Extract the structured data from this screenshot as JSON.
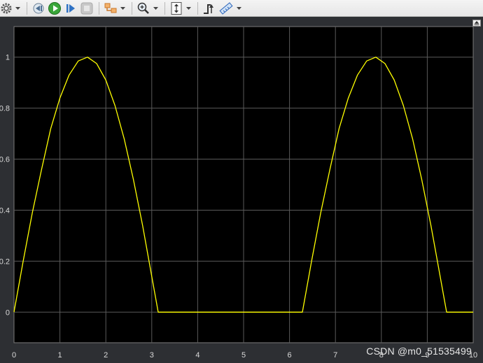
{
  "toolbar": {
    "buttons": [
      {
        "icon": "settings-gear-icon"
      },
      {
        "icon": "step-back-icon"
      },
      {
        "icon": "run-icon"
      },
      {
        "icon": "step-forward-icon"
      },
      {
        "icon": "stop-icon"
      },
      {
        "icon": "highlight-simulink-block-icon"
      },
      {
        "icon": "zoom-in-icon"
      },
      {
        "icon": "scale-axes-icon"
      },
      {
        "icon": "triggers-icon"
      },
      {
        "icon": "cursor-measurements-icon"
      }
    ]
  },
  "watermark": "CSDN @m0_51535499",
  "colors": {
    "background": "#2d2f33",
    "axes_background": "#000000",
    "grid": "#5a5a5a",
    "line": "#ffff00",
    "tick_text": "#d9d9d9"
  },
  "chart_data": {
    "type": "line",
    "title": "",
    "xlabel": "",
    "ylabel": "",
    "xlim": [
      0,
      10
    ],
    "ylim": [
      -0.12,
      1.12
    ],
    "grid": true,
    "xticks": [
      "0",
      "1",
      "2",
      "3",
      "4",
      "5",
      "6",
      "7",
      "8",
      "9",
      "10"
    ],
    "yticks": [
      "0",
      "0.2",
      "0.4",
      "0.6",
      "0.8",
      "1"
    ],
    "series": [
      {
        "color": "#ffff00",
        "x": [
          0,
          0.2,
          0.4,
          0.6,
          0.8,
          1.0,
          1.2,
          1.4,
          1.6,
          1.8,
          2.0,
          2.2,
          2.4,
          2.6,
          2.8,
          3.0,
          3.14,
          3.4,
          4.0,
          5.0,
          6.0,
          6.28,
          6.48,
          6.68,
          6.88,
          7.08,
          7.28,
          7.48,
          7.68,
          7.88,
          8.08,
          8.28,
          8.48,
          8.68,
          8.88,
          9.08,
          9.28,
          9.42,
          9.6,
          10.0
        ],
        "y": [
          0,
          0.2,
          0.39,
          0.56,
          0.72,
          0.84,
          0.93,
          0.985,
          1.0,
          0.975,
          0.91,
          0.81,
          0.68,
          0.52,
          0.34,
          0.14,
          0,
          0,
          0,
          0,
          0,
          0,
          0.2,
          0.39,
          0.56,
          0.72,
          0.84,
          0.93,
          0.985,
          1.0,
          0.975,
          0.91,
          0.81,
          0.68,
          0.52,
          0.34,
          0.14,
          0,
          0,
          0
        ]
      }
    ]
  }
}
